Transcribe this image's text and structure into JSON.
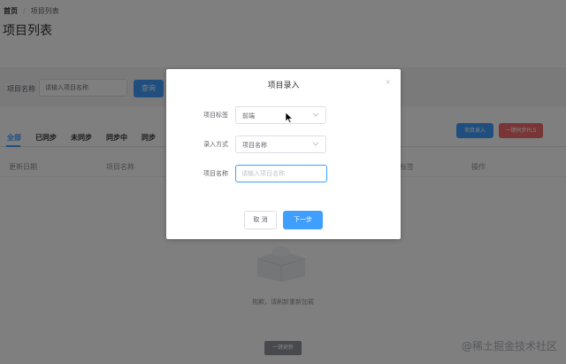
{
  "breadcrumb": {
    "home": "首页",
    "separator": "/",
    "current": "项目列表"
  },
  "page_title": "项目列表",
  "search": {
    "label": "项目名称",
    "placeholder": "请输入项目名称",
    "query_label": "查询"
  },
  "tabs": [
    {
      "label": "全部",
      "active": true
    },
    {
      "label": "已同步"
    },
    {
      "label": "未同步"
    },
    {
      "label": "同步中"
    },
    {
      "label": "同步"
    }
  ],
  "toolbar": {
    "entry_label": "项目录入",
    "sync_all_label": "一键同步PLS"
  },
  "table": {
    "columns": [
      "更新日期",
      "项目名称",
      "标签",
      "操作"
    ]
  },
  "empty": {
    "text": "抱歉，请刷新重新加载"
  },
  "bottom_button_label": "一键更新",
  "watermark": "@稀土掘金技术社区",
  "dialog": {
    "title": "项目录入",
    "close_glyph": "×",
    "fields": {
      "tag": {
        "label": "项目标签",
        "value": "前端"
      },
      "method": {
        "label": "录入方式",
        "value": "项目名称"
      },
      "name": {
        "label": "项目名称",
        "placeholder": "请输入项目名称"
      }
    },
    "cancel_label": "取 消",
    "next_label": "下一步"
  },
  "colors": {
    "primary": "#409eff",
    "danger": "#f56c6c",
    "overlay": "rgba(0,0,0,0.5)"
  }
}
